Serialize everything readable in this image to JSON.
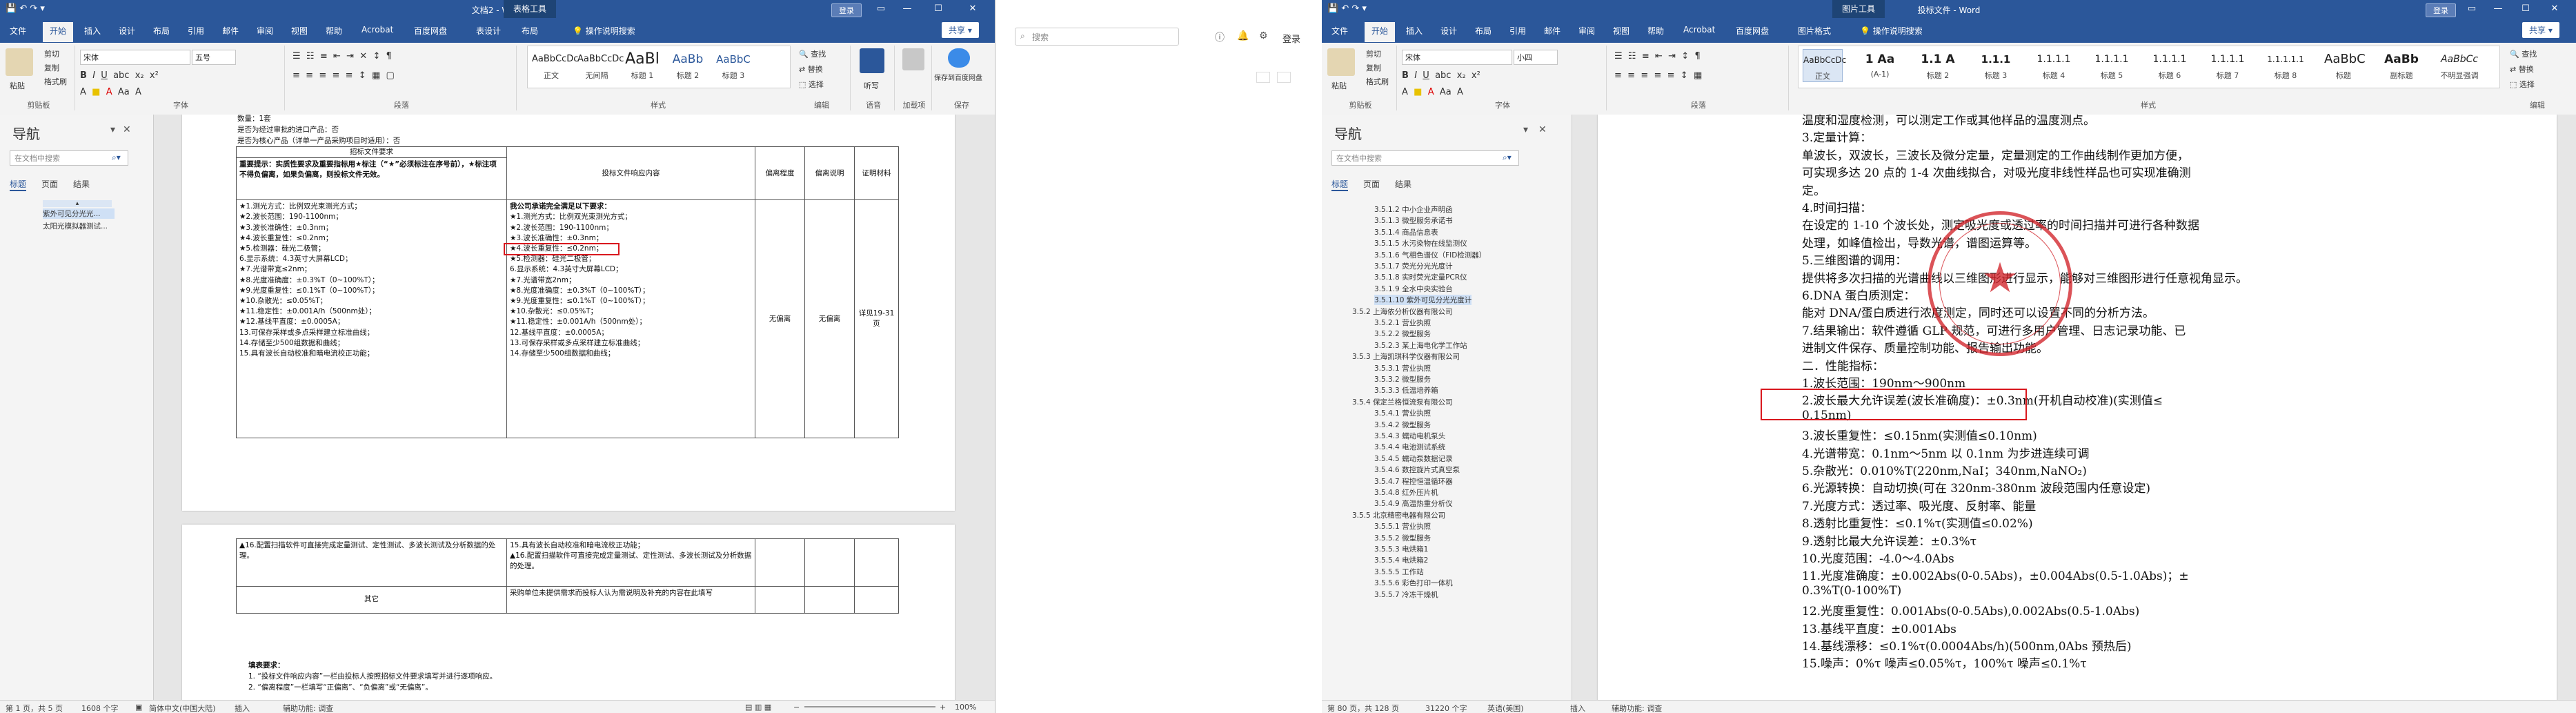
{
  "left_window": {
    "doc_title": "文档2 - Word",
    "context_tab": "表格工具",
    "login_btn": "登录",
    "share_btn": "共享",
    "tabs": [
      "文件",
      "开始",
      "插入",
      "设计",
      "布局",
      "引用",
      "邮件",
      "审阅",
      "视图",
      "帮助",
      "Acrobat",
      "百度网盘",
      "表设计",
      "布局"
    ],
    "search_tab": "操作说明搜索",
    "clipboard": {
      "paste": "粘贴",
      "cut": "剪切",
      "copy": "复制",
      "format": "格式刷",
      "label": "剪贴板"
    },
    "font": {
      "name": "宋体",
      "size": "五号",
      "label": "字体"
    },
    "paragraph_label": "段落",
    "styles": [
      {
        "preview": "AaBbCcDc",
        "name": "正文"
      },
      {
        "preview": "AaBbCcDc",
        "name": "无间隔"
      },
      {
        "preview": "AaBl",
        "name": "标题 1"
      },
      {
        "preview": "AaBb",
        "name": "标题 2"
      },
      {
        "preview": "AaBbC",
        "name": "标题 3"
      }
    ],
    "styles_label": "样式",
    "editing": {
      "find": "查找",
      "replace": "替换",
      "select": "选择",
      "label": "编辑"
    },
    "voice": {
      "dictate": "听写",
      "label": "语音"
    },
    "addin": {
      "label": "加载项"
    },
    "baidu": {
      "save": "保存到百度网盘",
      "label": "保存"
    },
    "nav": {
      "title": "导航",
      "search_placeholder": "在文档中搜索",
      "tabs": [
        "标题",
        "页面",
        "结果"
      ],
      "items": [
        "紫外可见分光光...",
        "太阳光模拟器测试..."
      ]
    },
    "doc": {
      "p1": "数量：1套",
      "p2": "是否为经过审批的进口产品：否",
      "p3": "是否为核心产品（详单一产品采购项目时适用）：否",
      "table": {
        "h_req": "招标文件要求",
        "h_resp": "投标文件响应内容",
        "h_dev": "偏离程度",
        "h_desc": "偏离说明",
        "h_proof": "证明材料",
        "note": "重要提示：实质性要求及重要指标用★标注（“★”必须标注在序号前），★标注项不得负偏离，如果负偏离，则投标文件无效。",
        "resp_intro": "我公司承诺完全满足以下要求：",
        "req_lines": [
          "★1.测光方式：比例双光束测光方式；",
          "★2.波长范围：190-1100nm；",
          "★3.波长准确性：±0.3nm；",
          "★4.波长重复性：≤0.2nm；",
          "★5.检测器：硅光二极管；",
          "6.显示系统：4.3英寸大屏幕LCD；",
          "★7.光谱带宽≤2nm；",
          "★8.光度准确度：±0.3%T（0~100%T）；",
          "★9.光度重复性：≤0.1%T（0~100%T）；",
          "★10.杂散光：≤0.05%T；",
          "★11.稳定性：±0.001A/h（500nm处）；",
          "★12.基线平直度：±0.0005A；",
          "13.可保存采样或多点采样建立标准曲线；",
          "14.存储至少500组数据和曲线；",
          "15.具有波长自动校准和暗电流校正功能；"
        ],
        "resp_lines": [
          "★1.测光方式：比例双光束测光方式；",
          "★2.波长范围：190-1100nm；",
          "★3.波长准确性：±0.3nm；",
          "★4.波长重复性：≤0.2nm；",
          "★5.检测器：硅光二极管；",
          "6.显示系统：4.3英寸大屏幕LCD；",
          "★7.光谱带宽2nm；",
          "★8.光度准确度：±0.3%T（0~100%T）；",
          "★9.光度重复性：≤0.1%T（0~100%T）；",
          "★10.杂散光：≤0.05%T；",
          "★11.稳定性：±0.001A/h（500nm处）；",
          "12.基线平直度：±0.0005A；",
          "13.可保存采样或多点采样建立标准曲线；",
          "14.存储至少500组数据和曲线；"
        ],
        "dev": "无偏离",
        "desc": "无偏离",
        "proof": "详见19-31页"
      },
      "table2": {
        "req": "▲16.配置扫描软件可直接完成定量测试、定性测试、多波长测试及分析数据的处理。",
        "resp1": "15.具有波长自动校准和暗电流校正功能；",
        "resp2": "▲16.配置扫描软件可直接完成定量测试、定性测试、多波长测试及分析数据的处理。",
        "other": "其它",
        "other_resp": "采购单位未提供需求而投标人认为需说明及补充的内容在此填写"
      },
      "notes_title": "填表要求：",
      "note1": "1. “投标文件响应内容”一栏由投标人按照招标文件要求填写并进行逐项响应。",
      "note2": "2. “偏离程度”一栏填写“正偏离”、“负偏离”或“无偏离”。"
    },
    "status": {
      "page": "第 1 页，共 5 页",
      "words": "1608 个字",
      "lang": "简体中文(中国大陆)",
      "insert": "插入",
      "accessibility": "辅助功能: 调查",
      "zoom": "100%"
    }
  },
  "middle_window": {
    "search_placeholder": "搜索",
    "login": "登录"
  },
  "right_window": {
    "doc_title": "投标文件 - Word",
    "context_tab": "图片工具",
    "login_btn": "登录",
    "share_btn": "共享",
    "tabs": [
      "文件",
      "开始",
      "插入",
      "设计",
      "布局",
      "引用",
      "邮件",
      "审阅",
      "视图",
      "帮助",
      "Acrobat",
      "百度网盘",
      "图片格式"
    ],
    "search_tab": "操作说明搜索",
    "font": {
      "name": "宋体",
      "size": "小四"
    },
    "styles": [
      {
        "preview": "AaBbCcDc",
        "name": "正文"
      },
      {
        "preview": "1 Aa",
        "name": "(A-1)"
      },
      {
        "preview": "1.1 A",
        "name": "标题 2"
      },
      {
        "preview": "1.1.1",
        "name": "标题 3"
      },
      {
        "preview": "1.1.1.1",
        "name": "标题 4"
      },
      {
        "preview": "1.1.1.1",
        "name": "标题 5"
      },
      {
        "preview": "1.1.1.1",
        "name": "标题 6"
      },
      {
        "preview": "1.1.1.1",
        "name": "标题 7"
      },
      {
        "preview": "1.1.1.1.1",
        "name": "标题 8"
      },
      {
        "preview": "AaBbC",
        "name": "标题"
      },
      {
        "preview": "AaBb",
        "name": "副标题"
      },
      {
        "preview": "AaBbCc",
        "name": "不明显强调"
      }
    ],
    "editing": {
      "find": "查找",
      "replace": "替换",
      "select": "选择"
    },
    "nav": {
      "title": "导航",
      "search_placeholder": "在文档中搜索",
      "tabs": [
        "标题",
        "页面",
        "结果"
      ],
      "items": [
        "3.5.1.2 中小企业声明函",
        "3.5.1.3 微型服务承诺书",
        "3.5.1.4 商品信息表",
        "3.5.1.5 水污染物在线监测仪",
        "3.5.1.6 气相色谱仪（FID检测器）",
        "3.5.1.7 荧光分光光度计",
        "3.5.1.8 实时荧光定量PCR仪",
        "3.5.1.9 全水中央实验台",
        "3.5.1.10 紫外可见分光光度计",
        "3.5.2 上海依分析仪器有限公司",
        "3.5.2.1 营业执照",
        "3.5.2.2 微型服务",
        "3.5.2.3 某上海电化学工作站",
        "3.5.3 上海凯琪科学仪器有限公司",
        "3.5.3.1 营业执照",
        "3.5.3.2 微型服务",
        "3.5.3.3 低温培养箱",
        "3.5.4 保定兰格恒流泵有限公司",
        "3.5.4.1 营业执照",
        "3.5.4.2 微型服务",
        "3.5.4.3 蠕动电机泵头",
        "3.5.4.4 电池测试系统",
        "3.5.4.5 蠕动泵数据记录",
        "3.5.4.6 数控旋片式真空泵",
        "3.5.4.7 程控恒温循环器",
        "3.5.4.8 红外压片机",
        "3.5.4.9 高温热重分析仪",
        "3.5.5 北京精密电器有限公司",
        "3.5.5.1 营业执照",
        "3.5.5.2 微型服务",
        "3.5.5.3 电烘箱1",
        "3.5.5.4 电烘箱2",
        "3.5.5.5 工作站",
        "3.5.5.6 彩色打印一体机",
        "3.5.5.7 冷冻干燥机"
      ]
    },
    "doc_lines": [
      "温度和湿度检测，可以测定工作或其他样品的温度测点。",
      "3.定量计算：",
      "单波长，双波长，三波长及微分定量，定量测定的工作曲线制作更加方便，",
      "可实现多达 20 点的 1-4 次曲线拟合，对吸光度非线性样品也可实现准确测",
      "定。",
      "4.时间扫描：",
      "在设定的 1-10 个波长处，测定吸光度或透过率的时间扫描并可进行各种数据",
      "处理，如峰值检出，导数光谱，谱图运算等。",
      "5.三维图谱的调用：",
      "提供将多次扫描的光谱曲线以三维图形进行显示，能够对三维图形进行任意视角显示。",
      "6.DNA 蛋白质测定：",
      "能对 DNA/蛋白质进行浓度测定，同时还可以设置不同的分析方法。",
      "7.结果输出：软件遵循 GLP 规范，可进行多用户管理、日志记录功能、已",
      "进制文件保存、质量控制功能、报告输出功能。",
      "二．性能指标："
    ],
    "highlight_line": "1.波长范围：190nm～900nm",
    "doc_lines2": [
      "2.波长最大允许误差(波长准确度)：±0.3nm(开机自动校准)(实测值≤",
      "0.15nm)",
      "3.波长重复性：≤0.15nm(实测值≤0.10nm)",
      "4.光谱带宽：0.1nm～5nm 以 0.1nm 为步进连续可调",
      "5.杂散光：0.010%T(220nm,NaI；340nm,NaNO₂)",
      "6.光源转换：自动切换(可在 320nm-380nm 波段范围内任意设定)",
      "7.光度方式：透过率、吸光度、反射率、能量",
      "8.透射比重复性：≤0.1%τ(实测值≤0.02%)",
      "9.透射比最大允许误差：±0.3%τ",
      "10.光度范围：-4.0～4.0Abs",
      "11.光度准确度：±0.002Abs(0-0.5Abs)，±0.004Abs(0.5-1.0Abs)；±",
      "0.3%T(0-100%T)",
      "12.光度重复性：0.001Abs(0-0.5Abs),0.002Abs(0.5-1.0Abs)",
      "13.基线平直度：±0.001Abs",
      "14.基线漂移：≤0.1%τ(0.0004Abs/h)(500nm,0Abs 预热后)",
      "15.噪声：0%τ 噪声≤0.05%τ，100%τ 噪声≤0.1%τ"
    ],
    "status": {
      "page": "第 80 页，共 128 页",
      "words": "31220 个字",
      "lang": "英语(美国)",
      "insert": "插入",
      "accessibility": "辅助功能: 调查"
    }
  },
  "colors": {
    "word_blue": "#2b579a",
    "highlight_red": "#d9181e",
    "seal_red": "#d2232a"
  }
}
